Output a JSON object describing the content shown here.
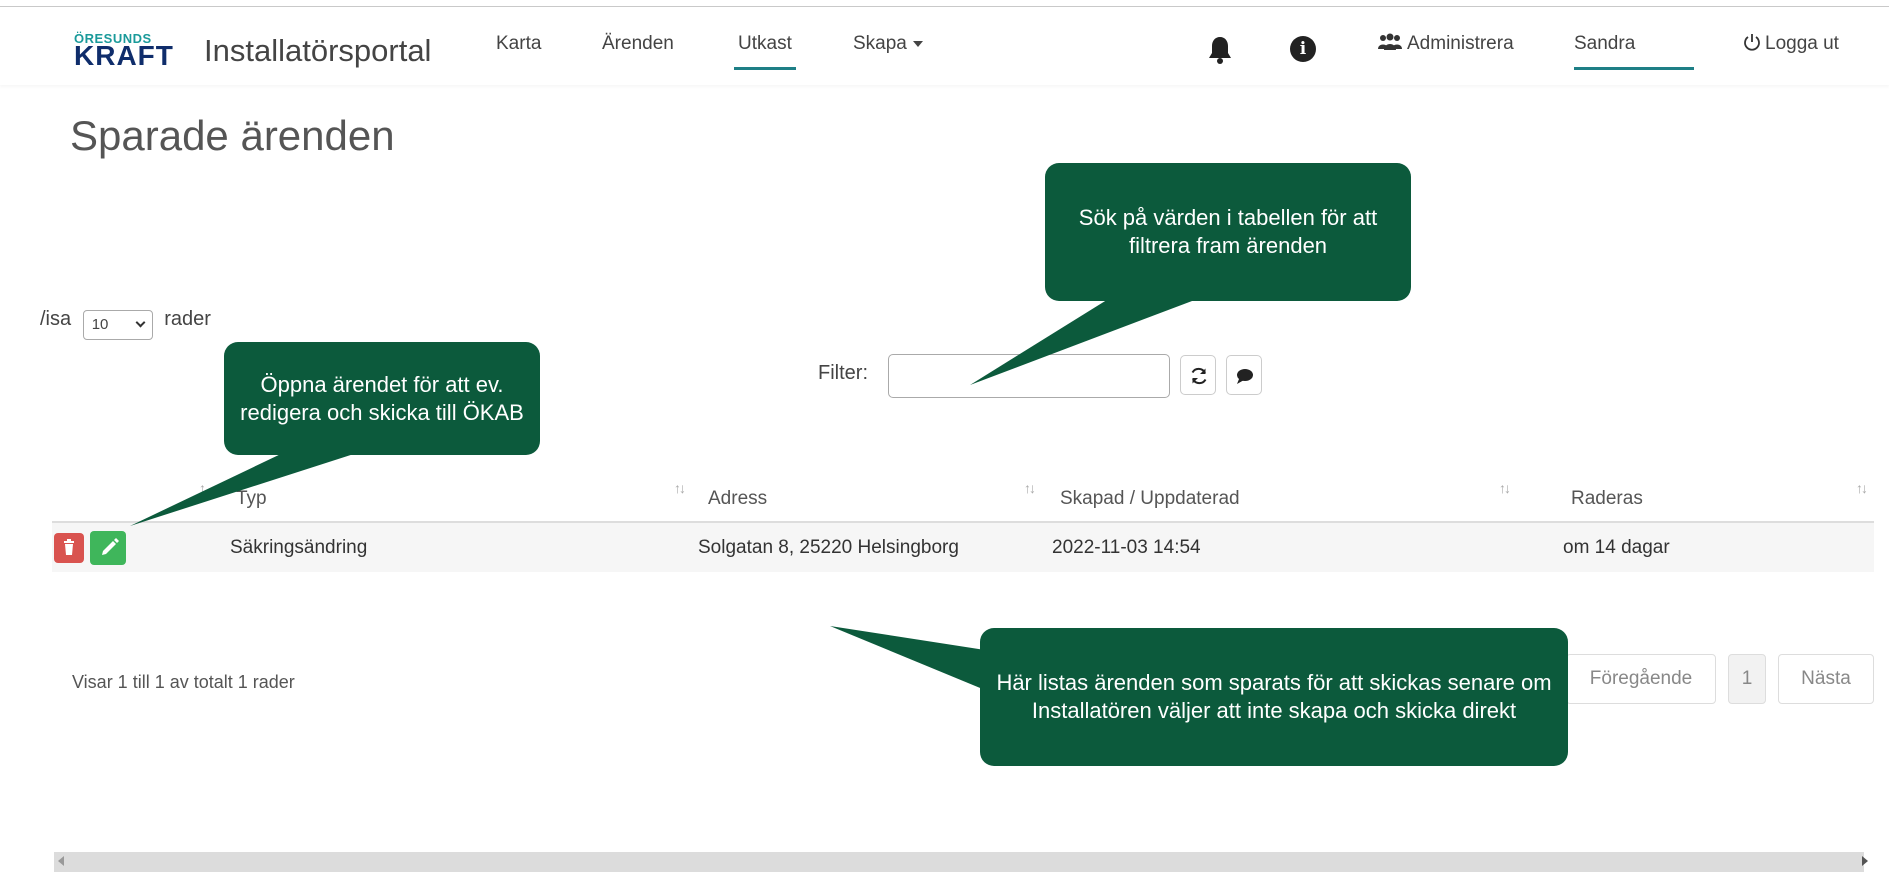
{
  "colors": {
    "accent": "#1e7f86",
    "callout": "#0c5a3c",
    "delete": "#d9534f",
    "edit": "#3fb65b",
    "logo_top": "#1a9a9a",
    "logo_bottom": "#0f2d6b"
  },
  "logo": {
    "line1": "ÖRESUNDS",
    "line2": "KRAFT"
  },
  "nav": {
    "brand": "Installatörsportal",
    "items": [
      {
        "label": "Karta"
      },
      {
        "label": "Ärenden"
      },
      {
        "label": "Utkast",
        "active": true
      },
      {
        "label": "Skapa",
        "dropdown": true
      }
    ],
    "icons": {
      "bell": "bell-icon",
      "info": "info-icon"
    },
    "admin": "Administrera",
    "user": "Sandra",
    "logout": "Logga ut"
  },
  "page": {
    "title": "Sparade ärenden"
  },
  "length_control": {
    "prefix": "/isa",
    "value": "10",
    "suffix": "rader"
  },
  "filter": {
    "label": "Filter:",
    "value": "",
    "placeholder": ""
  },
  "table": {
    "columns": [
      "",
      "Typ",
      "Adress",
      "Skapad / Uppdaterad",
      "Raderas"
    ],
    "rows": [
      {
        "typ": "Säkringsändring",
        "adress": "Solgatan 8, 25220 Helsingborg",
        "skapad": "2022-11-03 14:54",
        "raderas": "om 14 dagar"
      }
    ]
  },
  "info": "Visar 1 till 1 av totalt 1 rader",
  "pagination": {
    "prev": "Föregående",
    "current": "1",
    "next": "Nästa"
  },
  "callouts": {
    "search": "Sök på värden i tabellen för att filtrera fram ärenden",
    "open": "Öppna ärendet för att ev. redigera och skicka till ÖKAB",
    "saved": "Här listas ärenden som sparats för att skickas senare om Installatören väljer att inte skapa och skicka direkt"
  }
}
